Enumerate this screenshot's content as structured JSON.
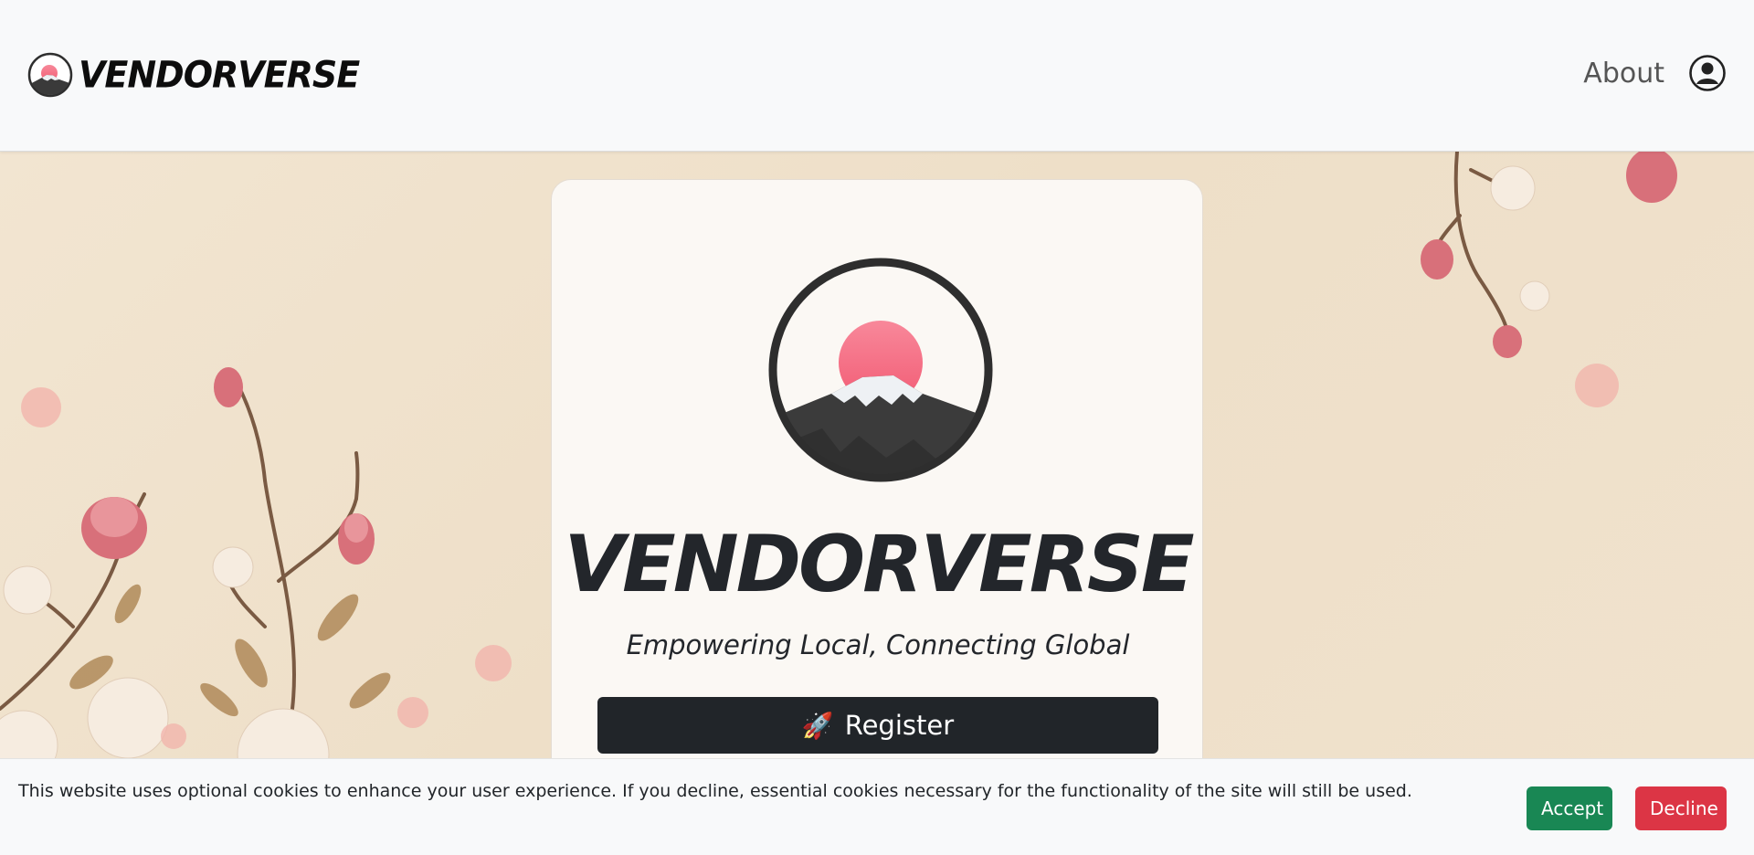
{
  "header": {
    "brand_name": "VENDORVERSE",
    "about_label": "About",
    "icons": {
      "logo": "mount-fuji-sun-logo",
      "user": "user-circle-icon"
    }
  },
  "hero": {
    "title": "VENDORVERSE",
    "tagline": "Empowering Local, Connecting Global",
    "register_icon": "🚀",
    "register_label": "Register"
  },
  "cookie_banner": {
    "message": "This website uses optional cookies to enhance your user experience. If you decline, essential cookies necessary for the functionality of the site will still be used.",
    "accept_label": "Accept",
    "decline_label": "Decline"
  },
  "colors": {
    "primary_dark": "#212529",
    "accept": "#198754",
    "decline": "#dc3545",
    "sun": "#f5677f",
    "background": "#efe2cf"
  }
}
